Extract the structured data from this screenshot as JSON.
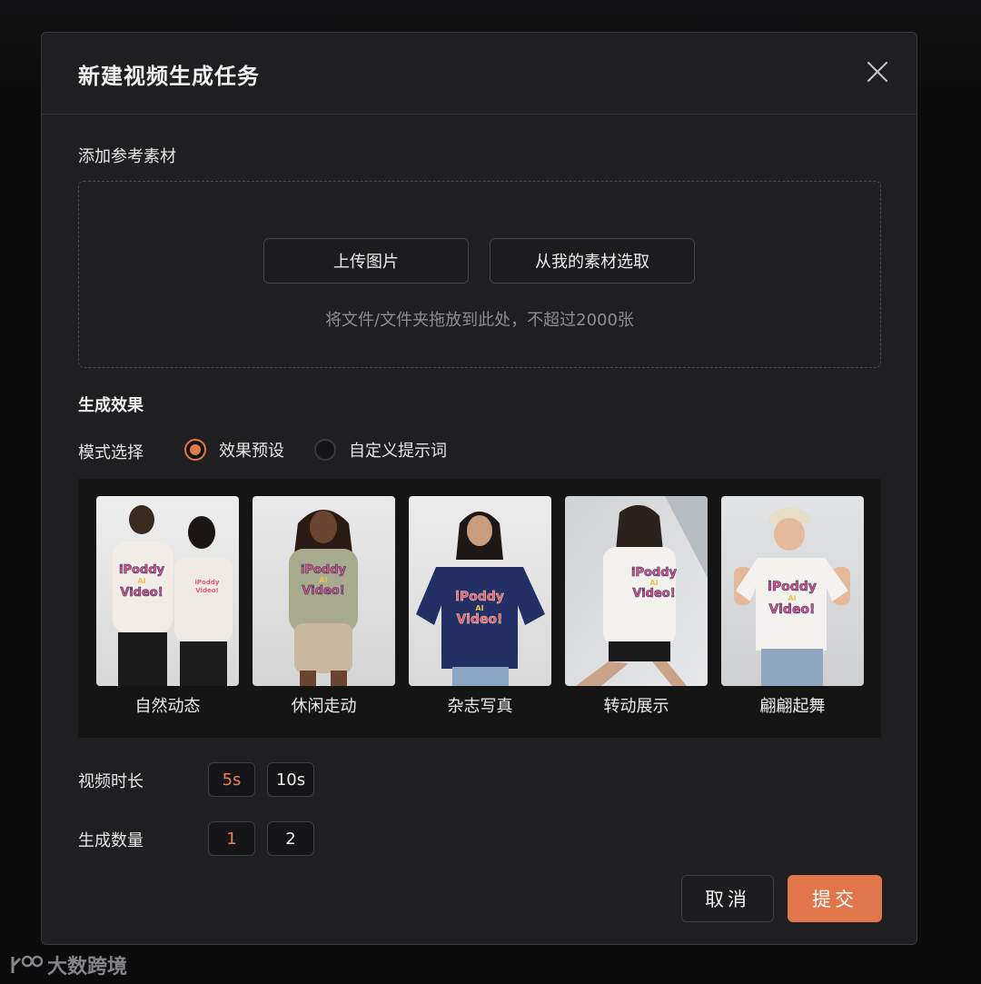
{
  "dialog": {
    "title": "新建视频生成任务",
    "close_icon": "close-icon"
  },
  "reference": {
    "label": "添加参考素材",
    "upload_image_label": "上传图片",
    "from_library_label": "从我的素材选取",
    "hint": "将文件/文件夹拖放到此处，不超过2000张"
  },
  "effect": {
    "section_title": "生成效果",
    "mode_label": "模式选择",
    "modes": [
      {
        "label": "效果预设",
        "selected": true
      },
      {
        "label": "自定义提示词",
        "selected": false
      }
    ],
    "presets": [
      {
        "name": "自然动态",
        "shirt_text": "iPoddy AI Video!"
      },
      {
        "name": "休闲走动",
        "shirt_text": "iPoddy AI Video!"
      },
      {
        "name": "杂志写真",
        "shirt_text": "iPoddy AI Video!"
      },
      {
        "name": "转动展示",
        "shirt_text": "iPoddy AI Video!"
      },
      {
        "name": "翩翩起舞",
        "shirt_text": "iPoddy AI Video!"
      }
    ]
  },
  "duration": {
    "label": "视频时长",
    "options": [
      "5s",
      "10s"
    ],
    "selected": "5s"
  },
  "count": {
    "label": "生成数量",
    "options": [
      "1",
      "2"
    ],
    "selected": "1"
  },
  "actions": {
    "cancel_label": "取消",
    "submit_label": "提交"
  },
  "watermark": {
    "text": "大数跨境"
  },
  "colors": {
    "accent": "#e0764a",
    "dialog_bg": "#1f1f21",
    "panel_bg": "#151516"
  }
}
